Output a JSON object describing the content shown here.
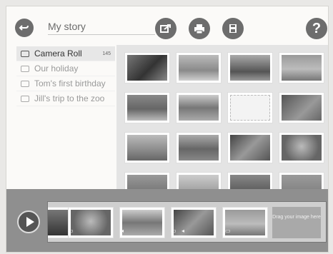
{
  "header": {
    "title": "My story"
  },
  "sidebar": {
    "albums": [
      {
        "label": "Camera Roll",
        "count": "145"
      },
      {
        "label": "Our holiday"
      },
      {
        "label": "Tom's first birthday"
      },
      {
        "label": "Jill's trip to the zoo"
      }
    ]
  },
  "grid": {
    "photos": [
      "tent-child",
      "beach-toddlers",
      "train",
      "group-children",
      "baby-grass",
      "beach-rock",
      "drawing",
      "dog",
      "playground-slide",
      "playground-steps",
      "mother-child",
      "woman-sunglasses",
      "people-1",
      "sign",
      "child-partial",
      "gray-wall"
    ]
  },
  "timeline": {
    "drag_text": "Drag your image here",
    "slots": [
      "partial",
      "woman-sunglasses",
      "beach-rock",
      "mother-child",
      "group-children"
    ]
  },
  "colors": {
    "accent": "#6d6d6d"
  }
}
